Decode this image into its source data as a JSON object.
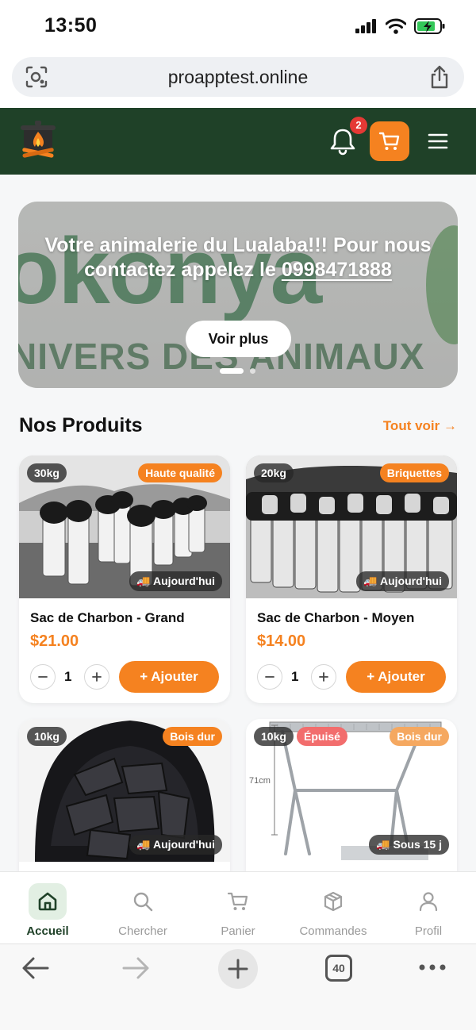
{
  "status_bar": {
    "time": "13:50"
  },
  "browser": {
    "url": "proapptest.online",
    "tab_count": "40"
  },
  "header": {
    "notification_count": "2"
  },
  "banner": {
    "text": "Votre animalerie du Lualaba!!! Pour nous contactez appelez le",
    "phone": "0998471888",
    "background_text": "okonya",
    "background_subtext": "NIVERS DES ANIMAUX",
    "button_label": "Voir plus"
  },
  "products_section": {
    "title": "Nos Produits",
    "see_all": "Tout voir →"
  },
  "products": [
    {
      "weight": "30kg",
      "tag": "Haute qualité",
      "delivery": "🚚 Aujourd'hui",
      "name": "Sac de Charbon - Grand",
      "price": "$21.00",
      "qty": "1",
      "add_label": "+ Ajouter"
    },
    {
      "weight": "20kg",
      "tag": "Briquettes",
      "delivery": "🚚 Aujourd'hui",
      "name": "Sac de Charbon - Moyen",
      "price": "$14.00",
      "qty": "1",
      "add_label": "+ Ajouter"
    },
    {
      "weight": "10kg",
      "tag": "Bois dur",
      "delivery": "🚚 Aujourd'hui"
    },
    {
      "weight": "10kg",
      "stock": "Épuisé",
      "tag": "Bois dur",
      "delivery": "🚚 Sous 15 j",
      "dimension": "71cm"
    }
  ],
  "tab_bar": [
    {
      "label": "Accueil",
      "icon": "home-icon",
      "active": true
    },
    {
      "label": "Chercher",
      "icon": "search-icon"
    },
    {
      "label": "Panier",
      "icon": "cart-icon"
    },
    {
      "label": "Commandes",
      "icon": "package-icon"
    },
    {
      "label": "Profil",
      "icon": "user-icon"
    }
  ],
  "colors": {
    "brand_green": "#1f4128",
    "accent_orange": "#f58220",
    "out_of_stock": "#f26d6d"
  }
}
